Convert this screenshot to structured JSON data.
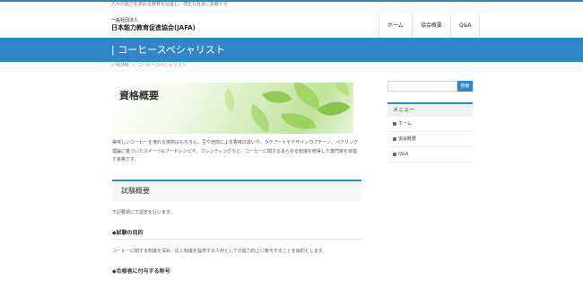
{
  "site": {
    "tagline": "人々の能力を高める教育を促進し、適正な社会に貢献する",
    "org_type": "一般社団法人",
    "org_name": "日本能力教育促進協会(JAFA)"
  },
  "nav": {
    "items": [
      {
        "label": "ホーム"
      },
      {
        "label": "協会概要"
      },
      {
        "label": "Q&A"
      }
    ]
  },
  "page": {
    "title": "|  コーヒースペシャリスト"
  },
  "breadcrumb": {
    "home_icon": "home-icon",
    "home": "HOME",
    "separator": ">",
    "current": "コーヒースペシャリスト"
  },
  "main": {
    "hero_title": "資格概要",
    "intro": "美味しいコーヒーを淹れる技術はもちろん、豆や焙煎による香味の違いや、ラテアートやデザインカプチーノ、ペアリング理論に基づいたスイーツ&フードレシピや、ブレンディングなど、コーヒーに関するあらゆる知識を修得した専門家を目指す資格です。",
    "section_title": "試験概要",
    "section_lead": "下記要領にて認定を行います。",
    "h_purpose": "◆試験の目的",
    "purpose_text": "コーヒーに関する知識を深め、広く知識を提供する人材としての能力向上に寄与することを目的とします。",
    "h_title": "◆合格者に付与する称号"
  },
  "sidebar": {
    "search_button": "検索",
    "menu_title": "メニュー",
    "menu_items": [
      {
        "label": "ホーム",
        "icon": "home-icon"
      },
      {
        "label": "協会概要",
        "icon": "info-icon"
      },
      {
        "label": "Q&A",
        "icon": "qa-icon"
      }
    ]
  },
  "colors": {
    "accent": "#2f87c8",
    "leaf_green": "#8cc84f"
  }
}
